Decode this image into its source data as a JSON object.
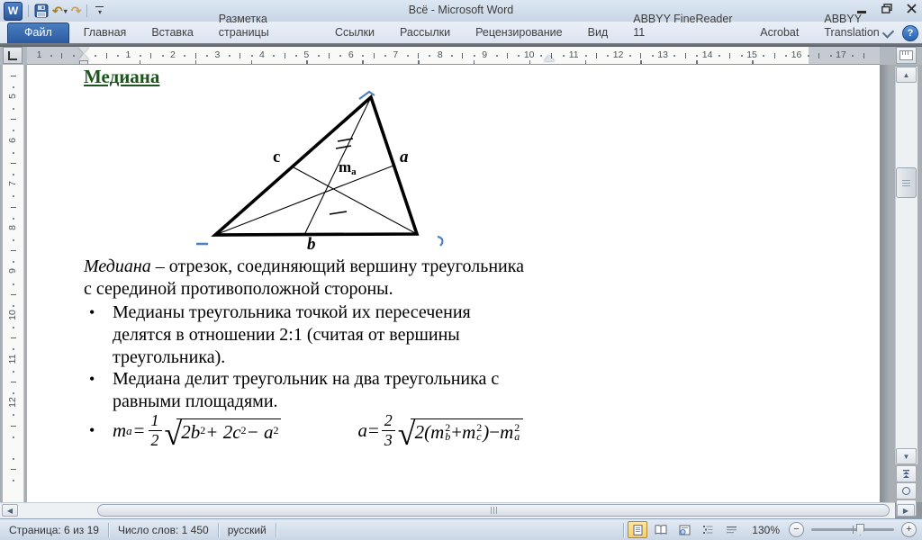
{
  "window": {
    "title": "Всё - Microsoft Word"
  },
  "qat": {
    "word_icon": "W",
    "undo_glyph": "↶",
    "redo_glyph": "↷"
  },
  "ribbon": {
    "tabs": [
      {
        "label": "Файл",
        "active": true
      },
      {
        "label": "Главная"
      },
      {
        "label": "Вставка"
      },
      {
        "label": "Разметка страницы"
      },
      {
        "label": "Ссылки"
      },
      {
        "label": "Рассылки"
      },
      {
        "label": "Рецензирование"
      },
      {
        "label": "Вид"
      },
      {
        "label": "ABBYY FineReader 11"
      },
      {
        "label": "Acrobat"
      },
      {
        "label": "ABBYY Translation"
      }
    ],
    "help_glyph": "?"
  },
  "ruler": {
    "h_margin_number": "1",
    "horizontal_numbers": [
      "1",
      "2",
      "3",
      "4",
      "5",
      "6",
      "7",
      "8",
      "9",
      "10",
      "11",
      "12",
      "13",
      "14",
      "15",
      "16",
      "17"
    ],
    "vertical_numbers": [
      "5",
      "6",
      "7",
      "8",
      "9",
      "10",
      "11",
      "12"
    ]
  },
  "document": {
    "heading": "Медиана",
    "figure": {
      "label_c": "c",
      "label_a": "a",
      "label_b": "b",
      "median_base": "m",
      "median_sub": "a"
    },
    "paragraph": {
      "lead_italic": "Медиана",
      "line1_rest": " – отрезок, соединяющий вершину треугольника",
      "line2": "с серединой противоположной стороны."
    },
    "bullet_char": "•",
    "bullets": [
      {
        "lines": [
          "Медианы треугольника точкой их пересечения",
          "делятся в  отношении 2:1 (считая от вершины",
          "треугольника)."
        ]
      },
      {
        "lines": [
          "Медиана делит треугольник на два треугольника с",
          "равными площадями."
        ]
      }
    ],
    "formulas": {
      "f1": {
        "lhs": "m",
        "lhs_sub": "a",
        "eq": "=",
        "num": "1",
        "den": "2",
        "sqrt": "√",
        "r1": "2b",
        "r1s": "2",
        "r2": " + 2c",
        "r2s": "2",
        "r3": " − a",
        "r3s": "2"
      },
      "f2": {
        "lhs": "a",
        "eq": "=",
        "num": "2",
        "den": "3",
        "sqrt": "√",
        "open": "2(",
        "m1": "m",
        "m1sup": "2",
        "m1sub": "b",
        "plus": "+",
        "m2": "m",
        "m2sup": "2",
        "m2sub": "c",
        "close": ")",
        "minus": "−",
        "m3": "m",
        "m3sup": "2",
        "m3sub": "a"
      }
    }
  },
  "scrollbar": {
    "up_glyph": "▲",
    "down_glyph": "▼",
    "left_glyph": "◀",
    "right_glyph": "▶"
  },
  "status_bar": {
    "page": "Страница: 6 из 19",
    "words": "Число слов: 1 450",
    "language": "русский",
    "zoom_level": "130%",
    "zoom_out_glyph": "−",
    "zoom_in_glyph": "+"
  }
}
